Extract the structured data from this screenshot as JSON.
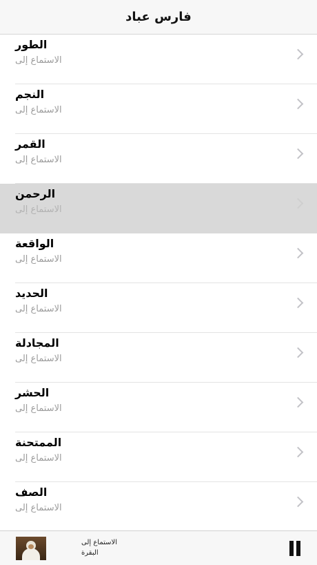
{
  "header": {
    "title": "فارس عباد"
  },
  "list": {
    "items": [
      {
        "title": "الطور",
        "subtitle": "الاستماع إلى",
        "selected": false
      },
      {
        "title": "النجم",
        "subtitle": "الاستماع إلى",
        "selected": false
      },
      {
        "title": "القمر",
        "subtitle": "الاستماع إلى",
        "selected": false
      },
      {
        "title": "الرحمن",
        "subtitle": "الاستماع إلى",
        "selected": true
      },
      {
        "title": "الواقعة",
        "subtitle": "الاستماع إلى",
        "selected": false
      },
      {
        "title": "الحديد",
        "subtitle": "الاستماع إلى",
        "selected": false
      },
      {
        "title": "المجادلة",
        "subtitle": "الاستماع إلى",
        "selected": false
      },
      {
        "title": "الحشر",
        "subtitle": "الاستماع إلى",
        "selected": false
      },
      {
        "title": "الممتحنة",
        "subtitle": "الاستماع إلى",
        "selected": false
      },
      {
        "title": "الصف",
        "subtitle": "الاستماع إلى",
        "selected": false
      }
    ],
    "chevron_icon": "chevron-right-icon"
  },
  "player": {
    "status": "الاستماع إلى",
    "track": "البقرة",
    "control_icon": "pause-icon",
    "artwork_icon": "reciter-photo"
  },
  "colors": {
    "selected_row": "#d9d9d9",
    "bar_background": "#f7f7f7",
    "subtitle": "#9b9b9b"
  }
}
